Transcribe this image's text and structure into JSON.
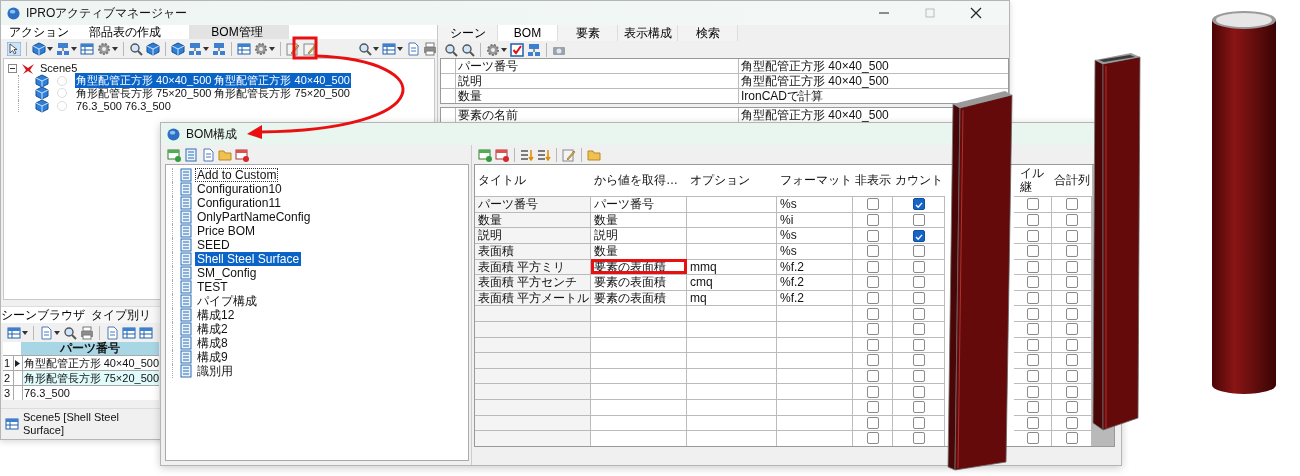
{
  "main_window": {
    "title": "IPROアクティブマネージャー",
    "menu_tabs": [
      {
        "label": "アクション",
        "selected": false
      },
      {
        "label": "部品表の作成",
        "selected": false
      },
      {
        "label": "BOM管理",
        "selected": true
      }
    ],
    "scene_tree": {
      "label": "Scene5",
      "expanded": true,
      "children": [
        {
          "label": "角型配管正方形 40×40_500 角型配管正方形 40×40_500",
          "selected": true
        },
        {
          "label": "角形配管長方形 75×20_500 角形配管長方形 75×20_500",
          "selected": false
        },
        {
          "label": "76.3_500 76.3_500",
          "selected": false
        }
      ]
    },
    "bottom_tabs": [
      {
        "label": "シーンブラウザ",
        "selected": true
      },
      {
        "label": "タイプ別リ",
        "selected": false
      }
    ],
    "parts_grid": {
      "columns": [
        "パーツ番号"
      ],
      "rows": [
        {
          "index": "1",
          "part_number": "角型配管正方形 40×40_500",
          "current": true,
          "selected": false
        },
        {
          "index": "2",
          "part_number": "角形配管長方形 75×20_500",
          "current": false,
          "selected": true
        },
        {
          "index": "3",
          "part_number": "76.3_500",
          "current": false,
          "selected": false
        }
      ]
    },
    "status_bar": "Scene5 [Shell Steel Surface]",
    "right_tabs": [
      {
        "label": "シーン",
        "selected": false
      },
      {
        "label": "BOM",
        "selected": true
      },
      {
        "label": "要素",
        "selected": false
      },
      {
        "label": "表示構成",
        "selected": false
      },
      {
        "label": "検索",
        "selected": false
      }
    ],
    "properties": [
      {
        "name": "パーツ番号",
        "value": "角型配管正方形 40×40_500"
      },
      {
        "name": "説明",
        "value": "角型配管正方形 40×40_500"
      },
      {
        "name": "数量",
        "value": "IronCADで計算"
      }
    ],
    "element_properties": [
      {
        "name": "要素の名前",
        "value": "角型配管正方形 40×40_500"
      }
    ]
  },
  "bom_dialog": {
    "title": "BOM構成",
    "configurations": [
      {
        "label": "Add to Custom",
        "selected": false,
        "focused": true
      },
      {
        "label": "Configuration10",
        "selected": false,
        "focused": false
      },
      {
        "label": "Configuration11",
        "selected": false,
        "focused": false
      },
      {
        "label": "OnlyPartNameConfig",
        "selected": false,
        "focused": false
      },
      {
        "label": "Price BOM",
        "selected": false,
        "focused": false
      },
      {
        "label": "SEED",
        "selected": false,
        "focused": false
      },
      {
        "label": "Shell Steel Surface",
        "selected": true,
        "focused": false
      },
      {
        "label": "SM_Config",
        "selected": false,
        "focused": false
      },
      {
        "label": "TEST",
        "selected": false,
        "focused": false
      },
      {
        "label": "パイプ構成",
        "selected": false,
        "focused": false
      },
      {
        "label": "構成12",
        "selected": false,
        "focused": false
      },
      {
        "label": "構成2",
        "selected": false,
        "focused": false
      },
      {
        "label": "構成8",
        "selected": false,
        "focused": false
      },
      {
        "label": "構成9",
        "selected": false,
        "focused": false
      },
      {
        "label": "識別用",
        "selected": false,
        "focused": false
      }
    ],
    "table": {
      "columns": [
        "タイトル",
        "から値を取得…",
        "オプション",
        "フォーマット",
        "非表示",
        "カウント",
        "イル継",
        "合計列"
      ],
      "rows": [
        {
          "title": "パーツ番号",
          "source": "パーツ番号",
          "format": "%s",
          "hidden": false,
          "count": true,
          "column_7": false,
          "total": false,
          "highlighted": false
        },
        {
          "title": "数量",
          "source": "数量",
          "format": "%i",
          "hidden": false,
          "count": false,
          "column_7": false,
          "total": false,
          "highlighted": false
        },
        {
          "title": "説明",
          "source": "説明",
          "format": "%s",
          "hidden": false,
          "count": true,
          "column_7": false,
          "total": false,
          "highlighted": false
        },
        {
          "title": "表面積",
          "source": "数量",
          "format": "%s",
          "hidden": false,
          "count": false,
          "column_7": false,
          "total": false,
          "highlighted": false
        },
        {
          "title": "表面積 平方ミリ",
          "source": "要素の表面積",
          "option": "mmq",
          "format": "%f.2",
          "hidden": false,
          "count": false,
          "column_7": false,
          "total": false,
          "highlighted": true
        },
        {
          "title": "表面積 平方センチ",
          "source": "要素の表面積",
          "option": "cmq",
          "format": "%f.2",
          "hidden": false,
          "count": false,
          "column_7": false,
          "total": false,
          "highlighted": false
        },
        {
          "title": "表面積 平方メートル",
          "source": "要素の表面積",
          "option": "mq",
          "format": "%f.2",
          "hidden": false,
          "count": false,
          "column_7": false,
          "total": false,
          "highlighted": false
        },
        {
          "hidden": false,
          "count": false,
          "column_7": false,
          "total": false,
          "highlighted": false
        },
        {
          "hidden": false,
          "count": false,
          "column_7": false,
          "total": false,
          "highlighted": false
        },
        {
          "hidden": false,
          "count": false,
          "column_7": false,
          "total": false,
          "highlighted": false
        },
        {
          "hidden": false,
          "count": false,
          "column_7": false,
          "total": false,
          "highlighted": false
        },
        {
          "hidden": false,
          "count": false,
          "column_7": false,
          "total": false,
          "highlighted": false
        },
        {
          "hidden": false,
          "count": false,
          "column_7": false,
          "total": false,
          "highlighted": false
        },
        {
          "hidden": false,
          "count": false,
          "column_7": false,
          "total": false,
          "highlighted": false
        },
        {
          "hidden": false,
          "count": false,
          "column_7": false,
          "total": false,
          "highlighted": false
        },
        {
          "hidden": false,
          "count": false,
          "column_7": false,
          "total": false,
          "highlighted": false
        }
      ]
    }
  }
}
